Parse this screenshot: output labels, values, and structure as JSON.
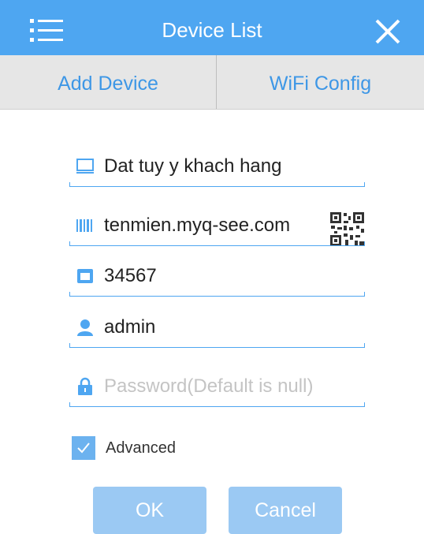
{
  "header": {
    "title": "Device List",
    "menu_icon": "menu-list-icon",
    "close_icon": "close-icon",
    "background_color": "#4ea6f1"
  },
  "tabs": [
    {
      "label": "Add Device"
    },
    {
      "label": "WiFi Config"
    }
  ],
  "form": {
    "device_name": {
      "value": "Dat tuy y khach hang",
      "icon": "monitor-icon"
    },
    "domain": {
      "value": "tenmien.myq-see.com",
      "icon": "barcode-icon",
      "scan_icon": "qr-code-icon"
    },
    "port": {
      "value": "34567",
      "icon": "port-icon"
    },
    "username": {
      "value": "admin",
      "icon": "user-icon"
    },
    "password": {
      "value": "",
      "placeholder": "Password(Default is null)",
      "icon": "lock-icon"
    },
    "advanced": {
      "label": "Advanced",
      "checked": true
    }
  },
  "buttons": {
    "ok_label": "OK",
    "cancel_label": "Cancel"
  },
  "colors": {
    "accent": "#4ea6f1",
    "tab_text": "#3e97e6",
    "button_bg": "#9bc9f3"
  }
}
